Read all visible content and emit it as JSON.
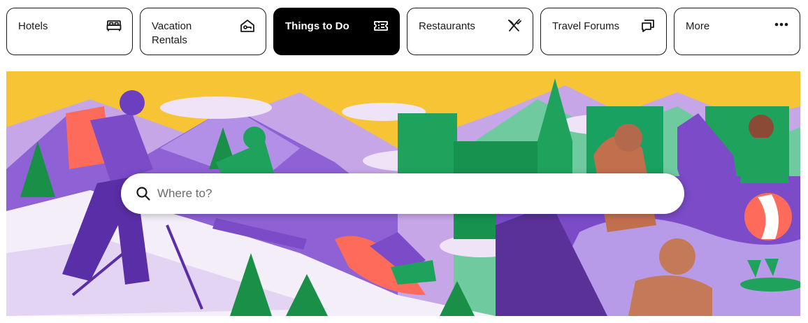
{
  "nav": {
    "tabs": [
      {
        "label": "Hotels",
        "icon": "bed-icon",
        "active": false
      },
      {
        "label": "Vacation Rentals",
        "icon": "house-key-icon",
        "active": false
      },
      {
        "label": "Things to Do",
        "icon": "ticket-icon",
        "active": true
      },
      {
        "label": "Restaurants",
        "icon": "fork-knife-icon",
        "active": false
      },
      {
        "label": "Travel Forums",
        "icon": "chat-bubbles-icon",
        "active": false
      },
      {
        "label": "More",
        "icon": "more-dots-icon",
        "active": false
      }
    ]
  },
  "search": {
    "placeholder": "Where to?",
    "value": ""
  },
  "colors": {
    "active_tab_bg": "#000000",
    "hero_sky": "#f7c436",
    "purple": "#7b4bc8",
    "green": "#1fa35c",
    "snow": "#f4eef8"
  }
}
